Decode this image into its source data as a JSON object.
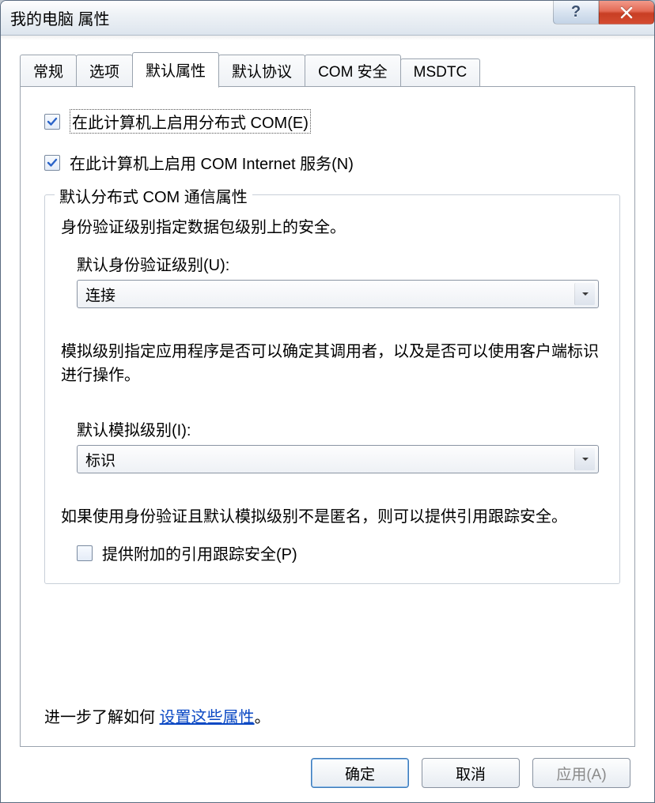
{
  "window": {
    "title": "我的电脑 属性"
  },
  "tabs": {
    "t0": "常规",
    "t1": "选项",
    "t2": "默认属性",
    "t3": "默认协议",
    "t4": "COM 安全",
    "t5": "MSDTC"
  },
  "checkboxes": {
    "enable_dcom_label": "在此计算机上启用分布式 COM(E)",
    "enable_dcom_checked": true,
    "enable_internet_label": "在此计算机上启用 COM Internet 服务(N)",
    "enable_internet_checked": true,
    "ref_tracking_label": "提供附加的引用跟踪安全(P)",
    "ref_tracking_checked": false
  },
  "group": {
    "title": "默认分布式 COM 通信属性",
    "auth_desc": "身份验证级别指定数据包级别上的安全。",
    "auth_label": "默认身份验证级别(U):",
    "auth_value": "连接",
    "imp_desc": "模拟级别指定应用程序是否可以确定其调用者，以及是否可以使用客户端标识进行操作。",
    "imp_label": "默认模拟级别(I):",
    "imp_value": "标识",
    "ref_desc": "如果使用身份验证且默认模拟级别不是匿名，则可以提供引用跟踪安全。"
  },
  "learnmore": {
    "prefix": "进一步了解如何",
    "link": "设置这些属性",
    "suffix": "。"
  },
  "buttons": {
    "ok": "确定",
    "cancel": "取消",
    "apply": "应用(A)"
  }
}
